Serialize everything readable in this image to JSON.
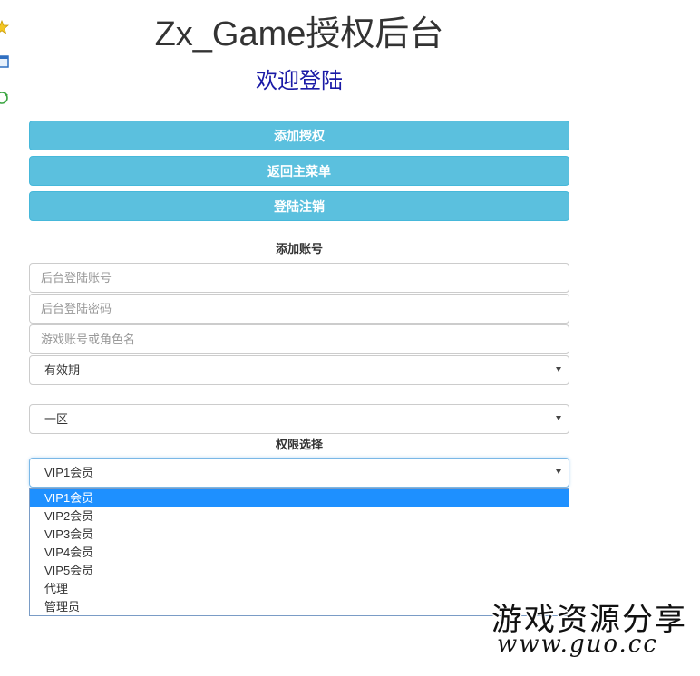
{
  "header": {
    "title": "Zx_Game授权后台",
    "welcome": "欢迎登陆"
  },
  "actions": {
    "add_auth": "添加授权",
    "back_menu": "返回主菜单",
    "logout": "登陆注销"
  },
  "add_account": {
    "heading": "添加账号",
    "username_placeholder": "后台登陆账号",
    "password_placeholder": "后台登陆密码",
    "game_account_placeholder": "游戏账号或角色名",
    "validity_value": "有效期",
    "region_value": "一区"
  },
  "permission": {
    "heading": "权限选择",
    "selected_value": "VIP1会员",
    "options": [
      "VIP1会员",
      "VIP2会员",
      "VIP3会员",
      "VIP4会员",
      "VIP5会员",
      "代理",
      "管理员"
    ]
  },
  "watermark": {
    "cn": "游戏资源分享",
    "url": "www.guo.cc"
  },
  "colors": {
    "button_bg": "#5bc0de",
    "welcome_text": "#1a1aa6",
    "option_highlight": "#1e90ff"
  },
  "icons": {
    "gutter": [
      "star-icon",
      "window-icon",
      "refresh-icon"
    ],
    "select_arrow": "chevron-down-icon"
  }
}
